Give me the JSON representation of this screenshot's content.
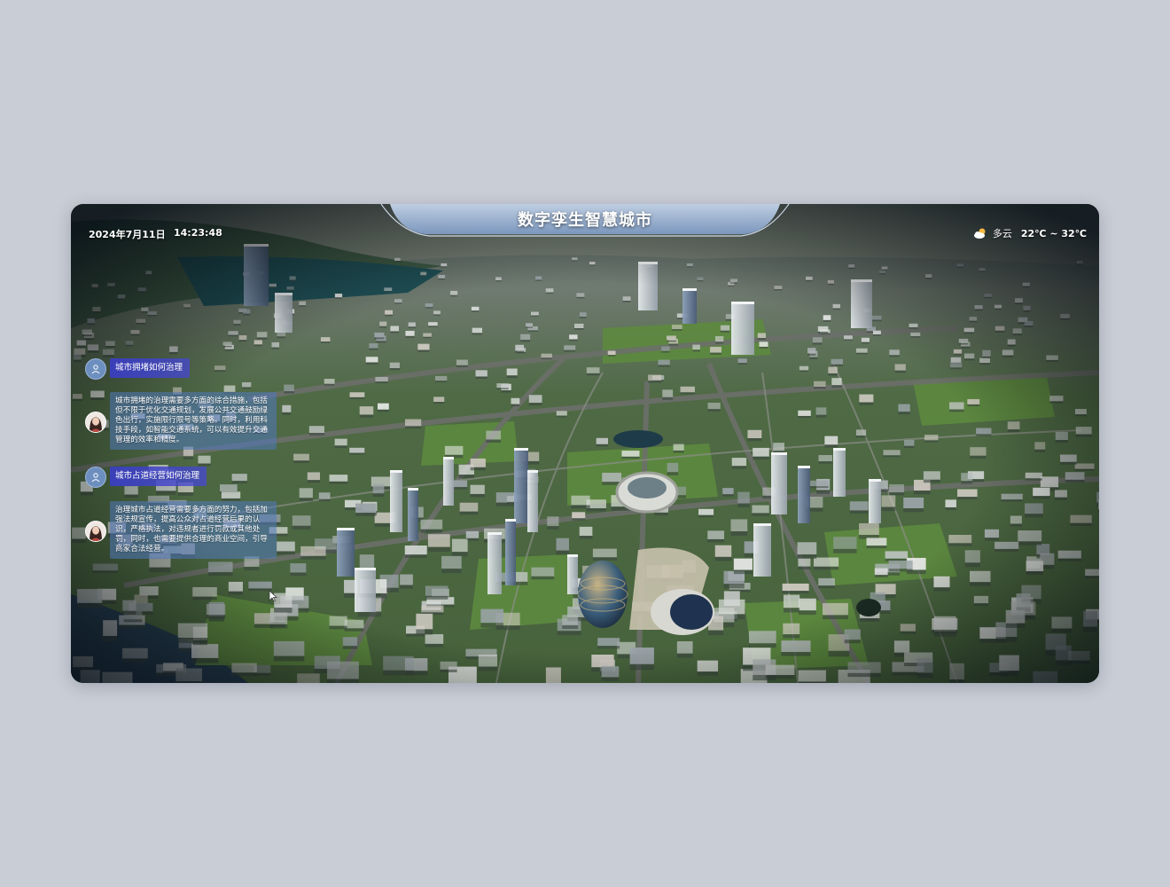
{
  "header": {
    "title": "数字孪生智慧城市",
    "date": "2024年7月11日",
    "time": "14:23:48",
    "weather": {
      "icon": "partly-cloudy-icon",
      "condition": "多云",
      "temperature": "22℃ ~ 32℃"
    }
  },
  "chat": {
    "messages": [
      {
        "role": "user",
        "icon": "user-icon",
        "text": "城市拥堵如何治理"
      },
      {
        "role": "assistant",
        "icon": "assistant-avatar",
        "text": "城市拥堵的治理需要多方面的综合措施，包括但不限于优化交通规划，发展公共交通鼓励绿色出行，实施限行限号等策略。同时，利用科技手段，如智能交通系统，可以有效提升交通管理的效率和精度。"
      },
      {
        "role": "user",
        "icon": "user-icon",
        "text": "城市占道经营如何治理"
      },
      {
        "role": "assistant",
        "icon": "assistant-avatar",
        "text": "治理城市占道经营需要多方面的努力，包括加强法规宣传，提高公众对占道经营后果的认识，严格执法，对违规者进行罚款或其他处罚，同时，也需要提供合理的商业空间，引导商家合法经营。"
      }
    ]
  },
  "colors": {
    "question_bubble": "#3a3ec4",
    "answer_bubble": "#5078be",
    "title_plate": "#8fb0d8"
  }
}
